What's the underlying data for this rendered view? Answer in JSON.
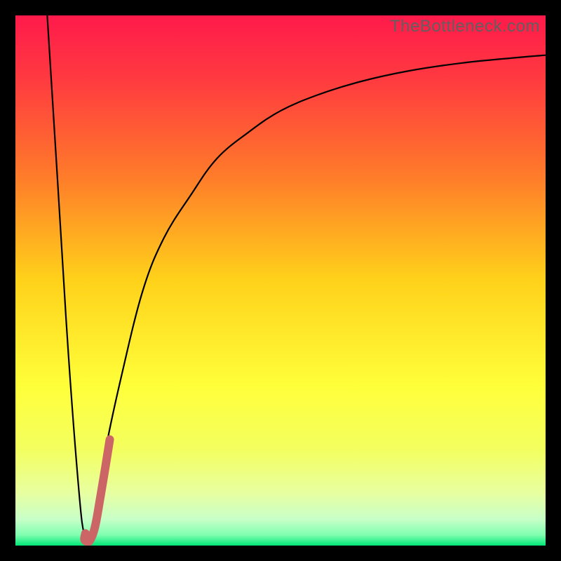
{
  "watermark": "TheBottleneck.com",
  "chart_data": {
    "type": "line",
    "title": "",
    "xlabel": "",
    "ylabel": "",
    "xlim": [
      0,
      100
    ],
    "ylim": [
      0,
      100
    ],
    "grid": false,
    "legend": false,
    "background_gradient": {
      "stops": [
        {
          "offset": 0.0,
          "color": "#ff1a4b"
        },
        {
          "offset": 0.12,
          "color": "#ff3a40"
        },
        {
          "offset": 0.3,
          "color": "#ff7a2a"
        },
        {
          "offset": 0.5,
          "color": "#ffd21a"
        },
        {
          "offset": 0.7,
          "color": "#ffff3a"
        },
        {
          "offset": 0.82,
          "color": "#f3ff60"
        },
        {
          "offset": 0.9,
          "color": "#e8ffa0"
        },
        {
          "offset": 0.95,
          "color": "#c8ffc8"
        },
        {
          "offset": 0.98,
          "color": "#80ffb0"
        },
        {
          "offset": 1.0,
          "color": "#00e676"
        }
      ]
    },
    "series": [
      {
        "name": "bottleneck-curve",
        "color": "#000000",
        "width": 2.2,
        "x": [
          6,
          8,
          10,
          12,
          13,
          14,
          15,
          17,
          20,
          24,
          28,
          33,
          38,
          44,
          50,
          57,
          65,
          74,
          84,
          94,
          100
        ],
        "y": [
          100,
          68,
          36,
          10,
          2,
          1,
          5,
          18,
          32,
          48,
          58,
          66,
          73,
          78,
          82,
          85,
          87.5,
          89.5,
          91,
          92,
          92.5
        ]
      },
      {
        "name": "highlight-segment",
        "color": "#cc6666",
        "width": 12,
        "linecap": "round",
        "x": [
          13.2,
          13.0,
          13.2,
          14.0,
          15.0,
          16.0,
          17.0,
          17.8
        ],
        "y": [
          2.3,
          1.3,
          0.9,
          0.9,
          3.5,
          9.0,
          15.0,
          20.0
        ]
      }
    ]
  }
}
